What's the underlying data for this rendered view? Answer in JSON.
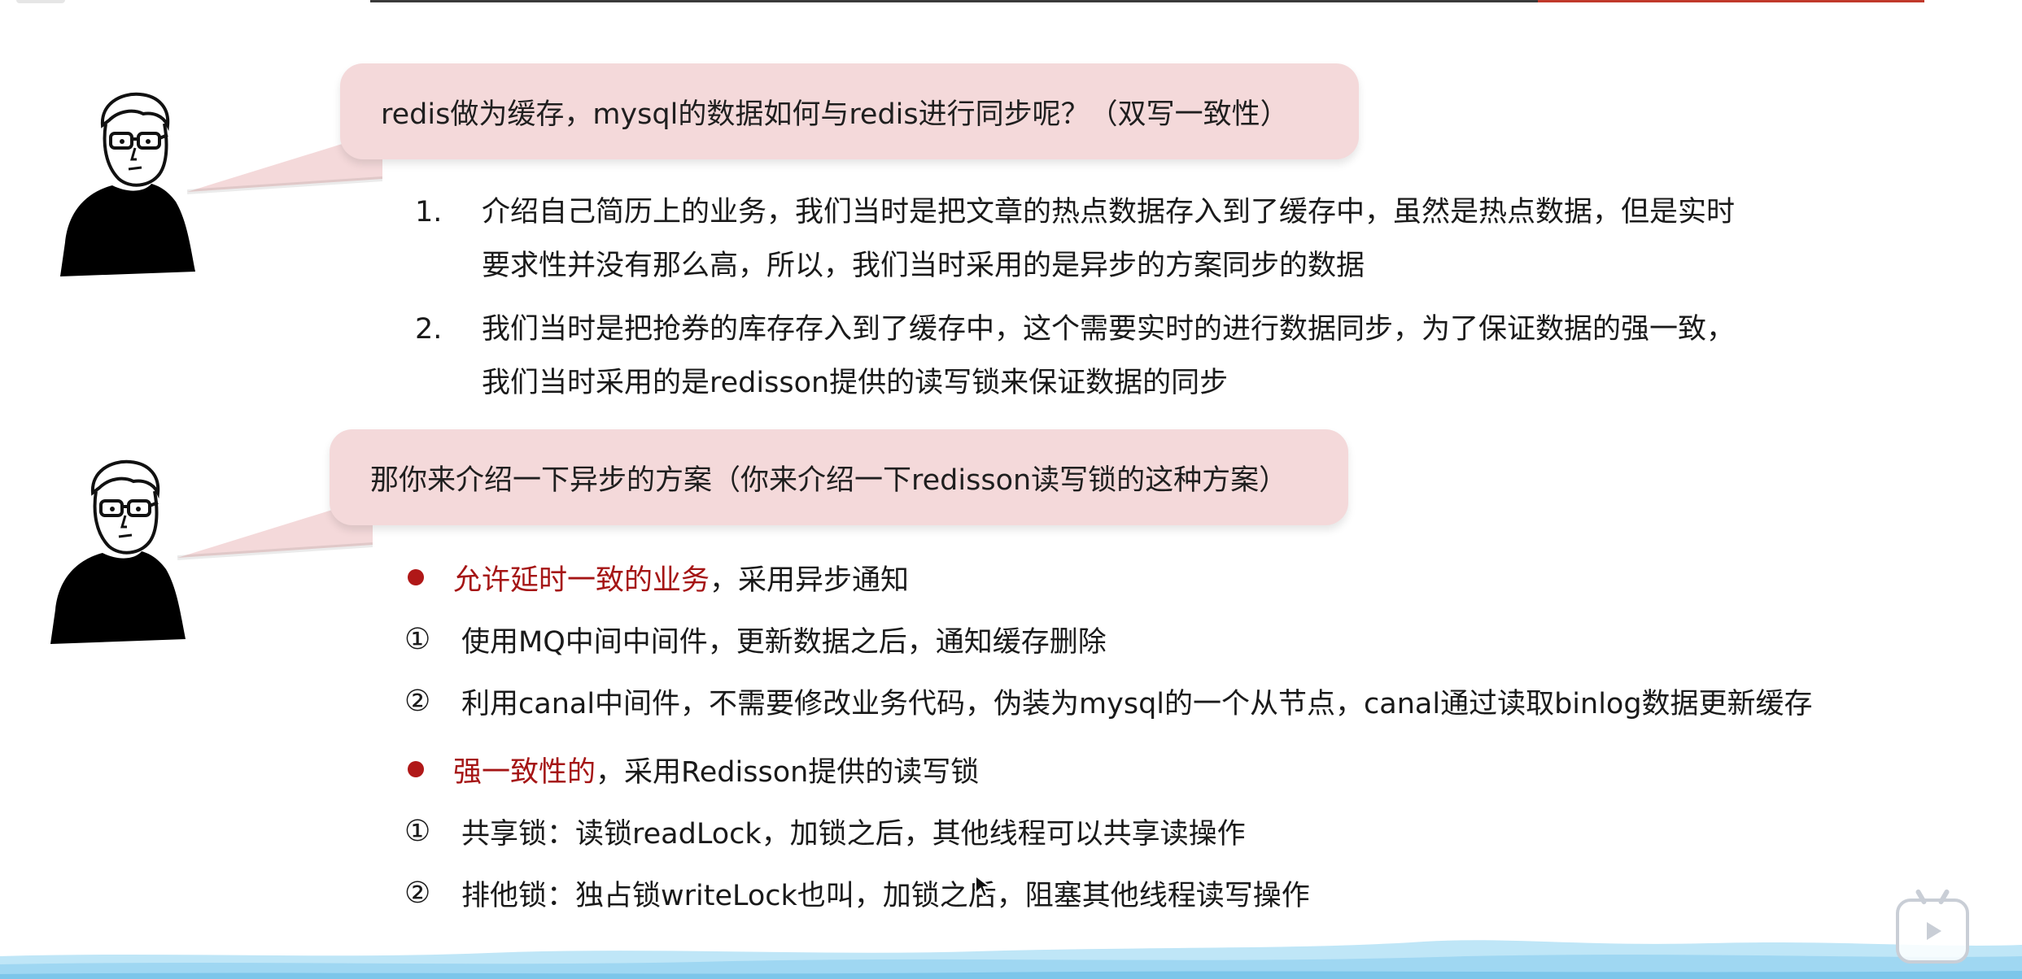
{
  "question1": {
    "text": "redis做为缓存，mysql的数据如何与redis进行同步呢？（双写一致性）"
  },
  "answers": [
    {
      "number": "1.",
      "line1": "介绍自己简历上的业务，我们当时是把文章的热点数据存入到了缓存中，虽然是热点数据，但是实时",
      "line2": "要求性并没有那么高，所以，我们当时采用的是异步的方案同步的数据"
    },
    {
      "number": "2.",
      "line1": "我们当时是把抢券的库存存入到了缓存中，这个需要实时的进行数据同步，为了保证数据的强一致，",
      "line2": "我们当时采用的是redisson提供的读写锁来保证数据的同步"
    }
  ],
  "question2": {
    "text": "那你来介绍一下异步的方案（你来介绍一下redisson读写锁的这种方案）"
  },
  "sections": [
    {
      "highlight": "允许延时一致的业务",
      "rest": "，采用异步通知",
      "items": [
        {
          "marker": "①",
          "text": "使用MQ中间中间件，更新数据之后，通知缓存删除"
        },
        {
          "marker": "②",
          "text": "利用canal中间件，不需要修改业务代码，伪装为mysql的一个从节点，canal通过读取binlog数据更新缓存"
        }
      ]
    },
    {
      "highlight": "强一致性的",
      "rest": "，采用Redisson提供的读写锁",
      "items": [
        {
          "marker": "①",
          "text": "共享锁：读锁readLock，加锁之后，其他线程可以共享读操作"
        },
        {
          "marker": "②",
          "text": "排他锁：独占锁writeLock也叫，加锁之后，阻塞其他线程读写操作"
        }
      ]
    }
  ],
  "colors": {
    "bubble": "#f4d9da",
    "highlight": "#a51515",
    "bullet": "#b01818",
    "water": "#9fd7f2"
  }
}
